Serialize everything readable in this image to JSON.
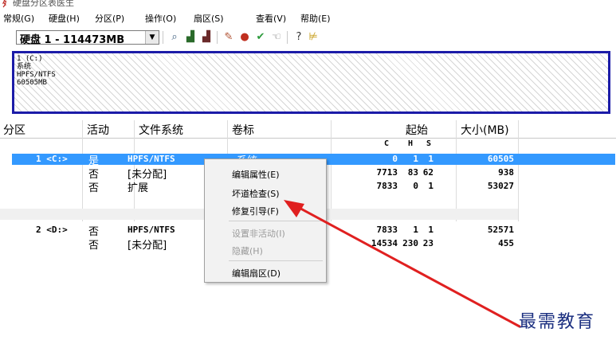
{
  "window": {
    "title": "硬盘分区表医生"
  },
  "menu": {
    "items": [
      "常规(G)",
      "硬盘(H)",
      "分区(P)",
      "操作(O)",
      "扇区(S)",
      "查看(V)",
      "帮助(E)"
    ]
  },
  "toolbar": {
    "disk_selector": "硬盘 1 - 114473MB",
    "icons": [
      "search-disk-icon",
      "partition-icon",
      "partition2-icon",
      "tool-icon",
      "magnifier-icon",
      "check-icon",
      "hand-icon",
      "help-icon",
      "cart-icon"
    ]
  },
  "diskmap": {
    "partition_label": [
      "1 (C:)",
      "系统",
      "HPFS/NTFS",
      "60505MB"
    ]
  },
  "table": {
    "headers": [
      "分区",
      "活动",
      "文件系统",
      "卷标",
      "起始",
      "大小(MB)"
    ],
    "subheaders": [
      "C",
      "H",
      "S"
    ],
    "rows": [
      {
        "part": "1 <C:>",
        "active": "是",
        "fs": "HPFS/NTFS",
        "label": "系统",
        "c": "0",
        "h": "1",
        "s": "1",
        "size": "60505",
        "selected": true
      },
      {
        "part": "",
        "active": "否",
        "fs": "[未分配]",
        "label": "",
        "c": "7713",
        "h": "83",
        "s": "62",
        "size": "938"
      },
      {
        "part": "",
        "active": "否",
        "fs": "扩展",
        "label": "",
        "c": "7833",
        "h": "0",
        "s": "1",
        "size": "53027"
      },
      {
        "part": "2 <D:>",
        "active": "否",
        "fs": "HPFS/NTFS",
        "label": "",
        "c": "7833",
        "h": "1",
        "s": "1",
        "size": "52571"
      },
      {
        "part": "",
        "active": "否",
        "fs": "[未分配]",
        "label": "",
        "c": "14534",
        "h": "230",
        "s": "23",
        "size": "455"
      }
    ]
  },
  "context_menu": {
    "items": [
      {
        "label": "编辑属性(E)",
        "enabled": true
      },
      {
        "label": "坏道检查(S)",
        "enabled": true
      },
      {
        "label": "修复引导(F)",
        "enabled": true
      },
      {
        "label": "设置非活动(I)",
        "enabled": false
      },
      {
        "label": "隐藏(H)",
        "enabled": false
      },
      {
        "label": "编辑扇区(D)",
        "enabled": true
      }
    ]
  },
  "watermark": "最需教育",
  "colors": {
    "selection": "#3399ff",
    "diskmap_border": "#1c1ca8",
    "arrow": "#e02020",
    "watermark": "#1b2f80"
  }
}
